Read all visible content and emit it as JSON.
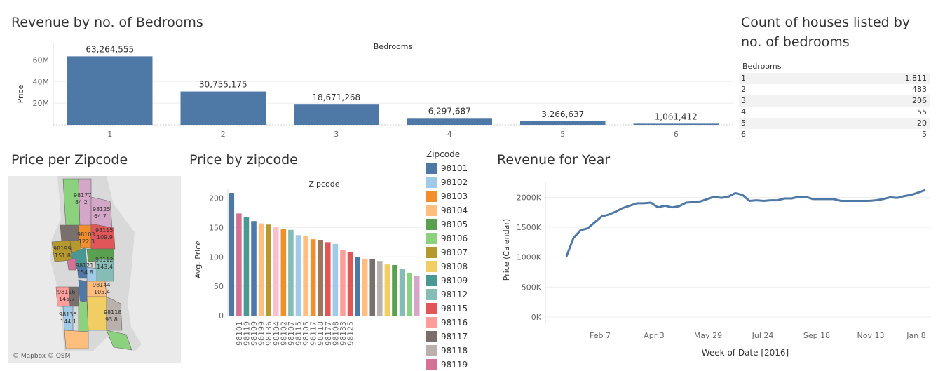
{
  "titles": {
    "revenue_bedrooms": "Revenue by no. of Bedrooms",
    "count_houses": "Count of houses listed by no. of bedrooms",
    "price_per_zip": "Price per Zipcode",
    "price_by_zip": "Price by zipcode",
    "revenue_year": "Revenue for Year"
  },
  "count_table": {
    "header": "Bedrooms",
    "rows": [
      {
        "label": "1",
        "value": "1,811"
      },
      {
        "label": "2",
        "value": "483"
      },
      {
        "label": "3",
        "value": "206"
      },
      {
        "label": "4",
        "value": "55"
      },
      {
        "label": "5",
        "value": "20"
      },
      {
        "label": "6",
        "value": "5"
      }
    ]
  },
  "map": {
    "credit": "© Mapbox © OSM",
    "labels": [
      {
        "zip": "98177",
        "value": "84.2"
      },
      {
        "zip": "98125",
        "value": "64.7"
      },
      {
        "zip": "98103",
        "value": "122.3"
      },
      {
        "zip": "98115",
        "value": "109.9"
      },
      {
        "zip": "98199",
        "value": "151.8"
      },
      {
        "zip": "98112",
        "value": "143.4"
      },
      {
        "zip": "98121",
        "value": "154.8"
      },
      {
        "zip": "98144",
        "value": "105.4"
      },
      {
        "zip": "98116",
        "value": "145.7"
      },
      {
        "zip": "98118",
        "value": "93.8"
      },
      {
        "zip": "98136",
        "value": "144.1"
      }
    ]
  },
  "legend": {
    "title": "Zipcode",
    "items": [
      {
        "label": "98101",
        "color": "#4e79a7"
      },
      {
        "label": "98102",
        "color": "#a0cbe8"
      },
      {
        "label": "98103",
        "color": "#f28e2b"
      },
      {
        "label": "98104",
        "color": "#ffbe7d"
      },
      {
        "label": "98105",
        "color": "#59a14f"
      },
      {
        "label": "98106",
        "color": "#8cd17d"
      },
      {
        "label": "98107",
        "color": "#b6992d"
      },
      {
        "label": "98108",
        "color": "#f1ce63"
      },
      {
        "label": "98109",
        "color": "#499894"
      },
      {
        "label": "98112",
        "color": "#86bcb6"
      },
      {
        "label": "98115",
        "color": "#e15759"
      },
      {
        "label": "98116",
        "color": "#ff9d9a"
      },
      {
        "label": "98117",
        "color": "#79706e"
      },
      {
        "label": "98118",
        "color": "#bab0ac"
      },
      {
        "label": "98119",
        "color": "#d37295"
      }
    ]
  },
  "chart_data": [
    {
      "type": "bar",
      "title": "Revenue by no. of Bedrooms",
      "xlabel": "Bedrooms",
      "ylabel": "Price",
      "categories": [
        "1",
        "2",
        "3",
        "4",
        "5",
        "6"
      ],
      "values": [
        63264555,
        30755175,
        18671268,
        6297687,
        3266637,
        1061412
      ],
      "value_labels": [
        "63,264,555",
        "30,755,175",
        "18,671,268",
        "6,297,687",
        "3,266,637",
        "1,061,412"
      ],
      "yticks": [
        20000000,
        40000000,
        60000000
      ],
      "ytick_labels": [
        "20M",
        "40M",
        "60M"
      ],
      "ylim": [
        0,
        70000000
      ],
      "color": "#4e79a7"
    },
    {
      "type": "bar",
      "title": "Price by zipcode",
      "xlabel": "Zipcode",
      "ylabel": "Avg. Price",
      "categories": [
        "98101",
        "98119",
        "98109",
        "98199",
        "98136",
        "98104",
        "98102",
        "98107",
        "98115",
        "98105",
        "98117",
        "98118",
        "98177",
        "98108",
        "98133",
        "98125"
      ],
      "values": [
        209,
        174,
        168,
        161,
        157,
        155,
        150,
        147,
        146,
        137,
        135,
        130,
        129,
        125,
        122,
        112,
        108,
        100,
        97,
        96,
        93,
        87,
        86,
        79,
        73,
        67
      ],
      "colors": [
        "#4e79a7",
        "#d37295",
        "#499894",
        "#4e79a7",
        "#ffbe7d",
        "#b6992d",
        "#fabfd2",
        "#f28e2b",
        "#86bcb6",
        "#a0cbe8",
        "#ffbe7d",
        "#f28e2b",
        "#9d7660",
        "#e15759",
        "#a0cbe8",
        "#ff9d9a",
        "#e15759",
        "#4e79a7",
        "#ffbe7d",
        "#79706e",
        "#bab0ac",
        "#f1ce63",
        "#59a14f",
        "#86bcb6",
        "#8cd17d",
        "#d4a6c8"
      ],
      "yticks": [
        0,
        50,
        100,
        150,
        200
      ],
      "ylim": [
        0,
        215
      ]
    },
    {
      "type": "line",
      "title": "Revenue for Year",
      "xlabel": "Week of Date [2016]",
      "ylabel": "Price (Calendar)",
      "xtick_labels": [
        "Feb 7",
        "Apr 3",
        "May 29",
        "Jul 24",
        "Sep 18",
        "Nov 13",
        "Jan 8"
      ],
      "yticks": [
        0,
        500000,
        1000000,
        1500000,
        2000000
      ],
      "ytick_labels": [
        "0K",
        "500K",
        "1000K",
        "1500K",
        "2000K"
      ],
      "ylim": [
        0,
        2250000
      ],
      "color": "#4e79a7",
      "values": [
        1010000,
        1320000,
        1450000,
        1480000,
        1580000,
        1680000,
        1710000,
        1760000,
        1820000,
        1860000,
        1900000,
        1900000,
        1910000,
        1830000,
        1860000,
        1830000,
        1850000,
        1910000,
        1920000,
        1930000,
        1970000,
        2010000,
        1990000,
        2010000,
        2070000,
        2040000,
        1940000,
        1950000,
        1940000,
        1950000,
        1950000,
        1980000,
        1980000,
        2010000,
        2010000,
        1970000,
        1970000,
        1970000,
        1970000,
        1940000,
        1940000,
        1940000,
        1940000,
        1940000,
        1950000,
        1970000,
        2000000,
        1990000,
        2020000,
        2040000,
        2080000,
        2120000
      ]
    }
  ]
}
